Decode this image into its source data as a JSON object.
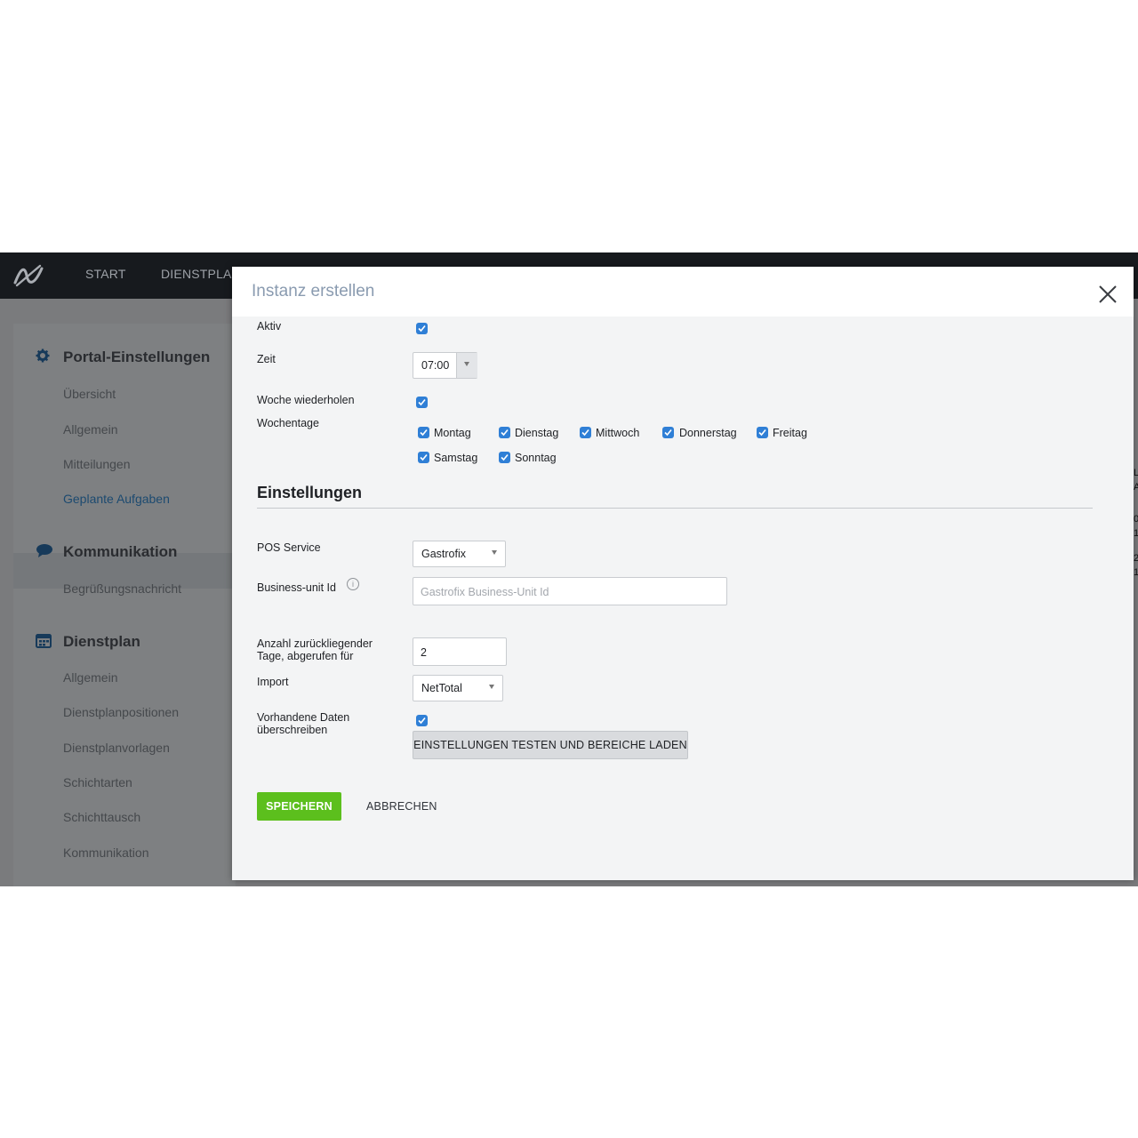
{
  "topbar": {
    "nav": [
      "START",
      "DIENSTPLAN"
    ]
  },
  "sidebar": {
    "sections": [
      {
        "title": "Portal-Einstellungen",
        "icon": "gear-icon",
        "items": [
          "Übersicht",
          "Allgemein",
          "Mitteilungen",
          "Geplante Aufgaben"
        ]
      },
      {
        "title": "Kommunikation",
        "icon": "speech-bubble-icon",
        "items": [
          "Begrüßungsnachricht"
        ]
      },
      {
        "title": "Dienstplan",
        "icon": "calendar-icon",
        "items": [
          "Allgemein",
          "Dienstplanpositionen",
          "Dienstplanvorlagen",
          "Schichtarten",
          "Schichttausch",
          "Kommunikation"
        ]
      }
    ],
    "active_item": "Geplante Aufgaben"
  },
  "right_edge": [
    "L",
    "A",
    "0",
    "1",
    "2",
    "1"
  ],
  "modal": {
    "title": "Instanz erstellen",
    "fields": {
      "aktiv": {
        "label": "Aktiv",
        "checked": true
      },
      "zeit": {
        "label": "Zeit",
        "value": "07:00"
      },
      "woche": {
        "label": "Woche wiederholen",
        "checked": true
      },
      "wochentage": {
        "label": "Wochentage",
        "days": [
          "Montag",
          "Dienstag",
          "Mittwoch",
          "Donnerstag",
          "Freitag",
          "Samstag",
          "Sonntag"
        ]
      }
    },
    "settings": {
      "title": "Einstellungen",
      "pos_service": {
        "label": "POS Service",
        "value": "Gastrofix"
      },
      "business_unit": {
        "label": "Business-unit Id",
        "placeholder": "Gastrofix Business-Unit Id",
        "info": "i"
      },
      "days_back": {
        "label_line1": "Anzahl zurückliegender",
        "label_line2": "Tage, abgerufen für",
        "value": "2"
      },
      "import": {
        "label": "Import",
        "value": "NetTotal"
      },
      "overwrite": {
        "label_line1": "Vorhandene Daten",
        "label_line2": "überschreiben",
        "checked": true
      },
      "test_button": "EINSTELLUNGEN TESTEN UND BEREICHE LADEN"
    },
    "footer": {
      "save": "SPEICHERN",
      "cancel": "ABBRECHEN"
    }
  },
  "colors": {
    "accent_blue": "#2f7fd6",
    "save_green": "#5cbf1d",
    "topbar": "#171a1e",
    "title_gray": "#8a9bb0"
  }
}
